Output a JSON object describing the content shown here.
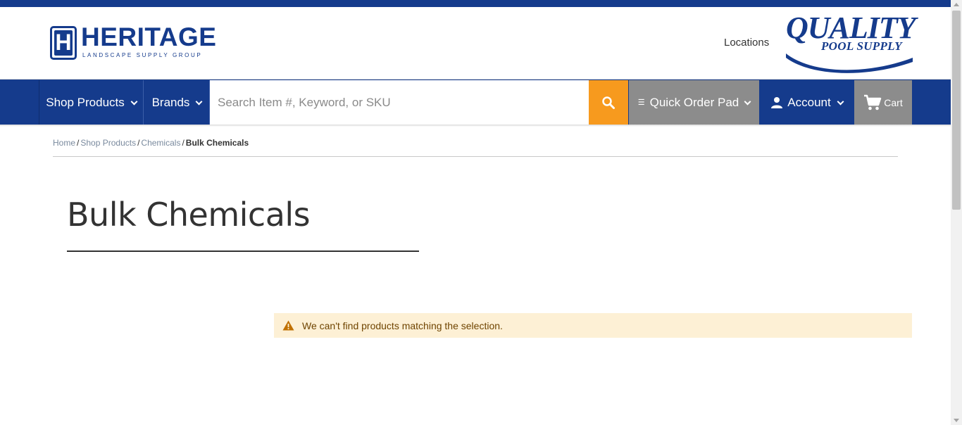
{
  "header": {
    "logo_left": {
      "word": "HERITAGE",
      "mark_letter": "H",
      "tagline": "LANDSCAPE SUPPLY GROUP"
    },
    "locations_label": "Locations",
    "logo_right": {
      "line1": "QUALITY",
      "line2": "POOL SUPPLY"
    }
  },
  "nav": {
    "shop_products": "Shop Products",
    "brands": "Brands",
    "search_placeholder": "Search Item #, Keyword, or SKU",
    "quick_order_pad": "Quick Order Pad",
    "account": "Account",
    "cart": "Cart"
  },
  "breadcrumb": {
    "items": [
      "Home",
      "Shop Products",
      "Chemicals"
    ],
    "current": "Bulk Chemicals"
  },
  "page": {
    "title": "Bulk Chemicals",
    "message": "We can't find products matching the selection."
  },
  "colors": {
    "brand_blue": "#153b8c",
    "search_orange": "#f79a1e",
    "nav_gray": "#8c8c8c",
    "message_bg": "#fdf0d5",
    "warning_icon": "#c07000"
  },
  "icons": {
    "search": "search-icon",
    "quick_order": "list-icon",
    "account": "user-icon",
    "cart": "cart-icon",
    "warning": "warning-icon",
    "chevron": "chevron-down-icon"
  }
}
